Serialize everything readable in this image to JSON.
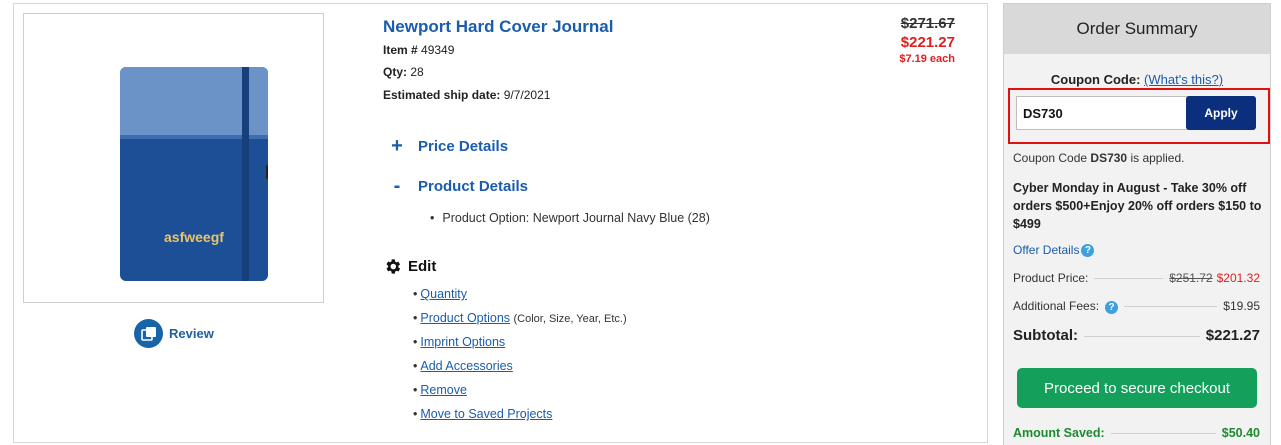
{
  "product": {
    "title": "Newport Hard Cover Journal",
    "item_label": "Item #",
    "item_number": "49349",
    "qty_label": "Qty:",
    "qty": "28",
    "ship_label": "Estimated ship date:",
    "ship_date": "9/7/2021",
    "imprint_text": "asfweegf",
    "review_label": "Review",
    "price_original": "$271.67",
    "price_current": "$221.27",
    "price_each": "$7.19 each"
  },
  "details": {
    "price_details_sign": "+",
    "price_details_label": "Price Details",
    "product_details_sign": "-",
    "product_details_label": "Product Details",
    "product_option": "Product Option: Newport Journal Navy Blue (28)"
  },
  "edit": {
    "heading": "Edit",
    "links": {
      "quantity": "Quantity",
      "product_options": "Product Options",
      "product_options_note": "(Color, Size, Year, Etc.)",
      "imprint_options": "Imprint Options",
      "add_accessories": "Add Accessories",
      "remove": "Remove",
      "move_to_saved": "Move to Saved Projects"
    }
  },
  "summary": {
    "heading": "Order Summary",
    "coupon_label": "Coupon Code:",
    "whats_this": "(What's this?)",
    "coupon_value": "DS730",
    "apply_label": "Apply",
    "applied_prefix": "Coupon Code",
    "applied_code": "DS730",
    "applied_suffix": "is applied.",
    "promo_text": "Cyber Monday in August - Take 30% off orders $500+Enjoy 20% off orders $150 to $499",
    "offer_details": "Offer Details",
    "product_price_label": "Product Price:",
    "product_price_original": "$251.72",
    "product_price_current": "$201.32",
    "additional_fees_label": "Additional Fees:",
    "additional_fees_value": "$19.95",
    "subtotal_label": "Subtotal:",
    "subtotal_value": "$221.27",
    "checkout_label": "Proceed to secure checkout",
    "saved_label": "Amount Saved:",
    "saved_value": "$50.40"
  },
  "colors": {
    "link_blue": "#1a5cad",
    "price_red": "#e02020",
    "checkout_green": "#14a05b",
    "apply_navy": "#0c2f7d",
    "coupon_highlight": "#e01010"
  }
}
